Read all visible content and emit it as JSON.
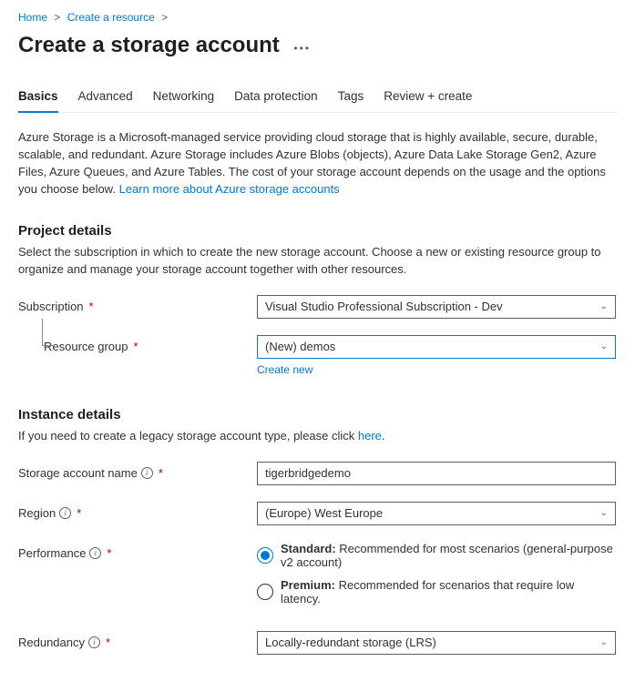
{
  "breadcrumb": {
    "items": [
      "Home",
      "Create a resource"
    ]
  },
  "page": {
    "title": "Create a storage account"
  },
  "tabs": [
    {
      "label": "Basics",
      "active": true
    },
    {
      "label": "Advanced",
      "active": false
    },
    {
      "label": "Networking",
      "active": false
    },
    {
      "label": "Data protection",
      "active": false
    },
    {
      "label": "Tags",
      "active": false
    },
    {
      "label": "Review + create",
      "active": false
    }
  ],
  "intro": {
    "text": "Azure Storage is a Microsoft-managed service providing cloud storage that is highly available, secure, durable, scalable, and redundant. Azure Storage includes Azure Blobs (objects), Azure Data Lake Storage Gen2, Azure Files, Azure Queues, and Azure Tables. The cost of your storage account depends on the usage and the options you choose below.",
    "link": "Learn more about Azure storage accounts"
  },
  "project": {
    "heading": "Project details",
    "desc": "Select the subscription in which to create the new storage account. Choose a new or existing resource group to organize and manage your storage account together with other resources.",
    "subscription_label": "Subscription",
    "subscription_value": "Visual Studio Professional Subscription - Dev",
    "rg_label": "Resource group",
    "rg_value": "(New) demos",
    "rg_create_link": "Create new"
  },
  "instance": {
    "heading": "Instance details",
    "legacy_text": "If you need to create a legacy storage account type, please click ",
    "legacy_link": "here",
    "legacy_tail": ".",
    "name_label": "Storage account name",
    "name_value": "tigerbridgedemo",
    "region_label": "Region",
    "region_value": "(Europe) West Europe",
    "perf_label": "Performance",
    "perf_options": {
      "standard_bold": "Standard:",
      "standard_rest": " Recommended for most scenarios (general-purpose v2 account)",
      "premium_bold": "Premium:",
      "premium_rest": " Recommended for scenarios that require low latency."
    },
    "redundancy_label": "Redundancy",
    "redundancy_value": "Locally-redundant storage (LRS)"
  }
}
